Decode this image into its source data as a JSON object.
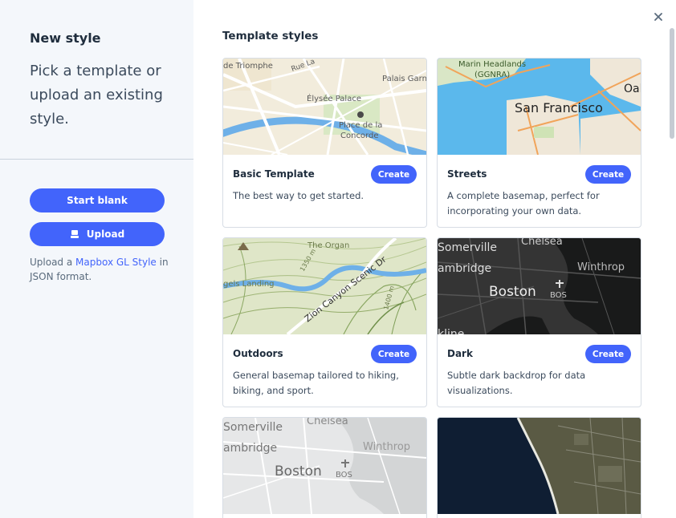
{
  "sidebar": {
    "title": "New style",
    "description": "Pick a template or upload an existing style.",
    "start_blank_label": "Start blank",
    "upload_label": "Upload",
    "help_prefix": "Upload a ",
    "help_link": "Mapbox GL Style",
    "help_suffix": " in JSON format."
  },
  "main": {
    "title": "Template styles",
    "cards": [
      {
        "name": "Basic Template",
        "button": "Create",
        "description": "The best way to get started."
      },
      {
        "name": "Streets",
        "button": "Create",
        "description": "A complete basemap, perfect for incorporating your own data."
      },
      {
        "name": "Outdoors",
        "button": "Create",
        "description": "General basemap tailored to hiking, biking, and sport."
      },
      {
        "name": "Dark",
        "button": "Create",
        "description": "Subtle dark backdrop for data visualizations."
      }
    ]
  },
  "map_labels": {
    "basic": [
      "de Triomphe",
      "Rue La",
      "Palais Garn",
      "Élysée Palace",
      "Place de la",
      "Concorde"
    ],
    "streets": [
      "Marin Headlands",
      "(GGNRA)",
      "San Francisco",
      "Oal"
    ],
    "outdoors": [
      "The Organ",
      "gels Landing",
      "Zion Canyon Scenic Dr",
      "1350 m",
      "1400 m"
    ],
    "dark": [
      "Somerville",
      "Chelsea",
      "ambridge",
      "Winthrop",
      "Boston",
      "BOS",
      "kline"
    ],
    "light": [
      "Somerville",
      "Chelsea",
      "ambridge",
      "Winthrop",
      "Boston",
      "BOS"
    ]
  },
  "colors": {
    "accent": "#4264fb",
    "sidebar_bg": "#f4f7fb"
  },
  "icons": {
    "upload": "upload-icon",
    "close": "close-icon"
  }
}
